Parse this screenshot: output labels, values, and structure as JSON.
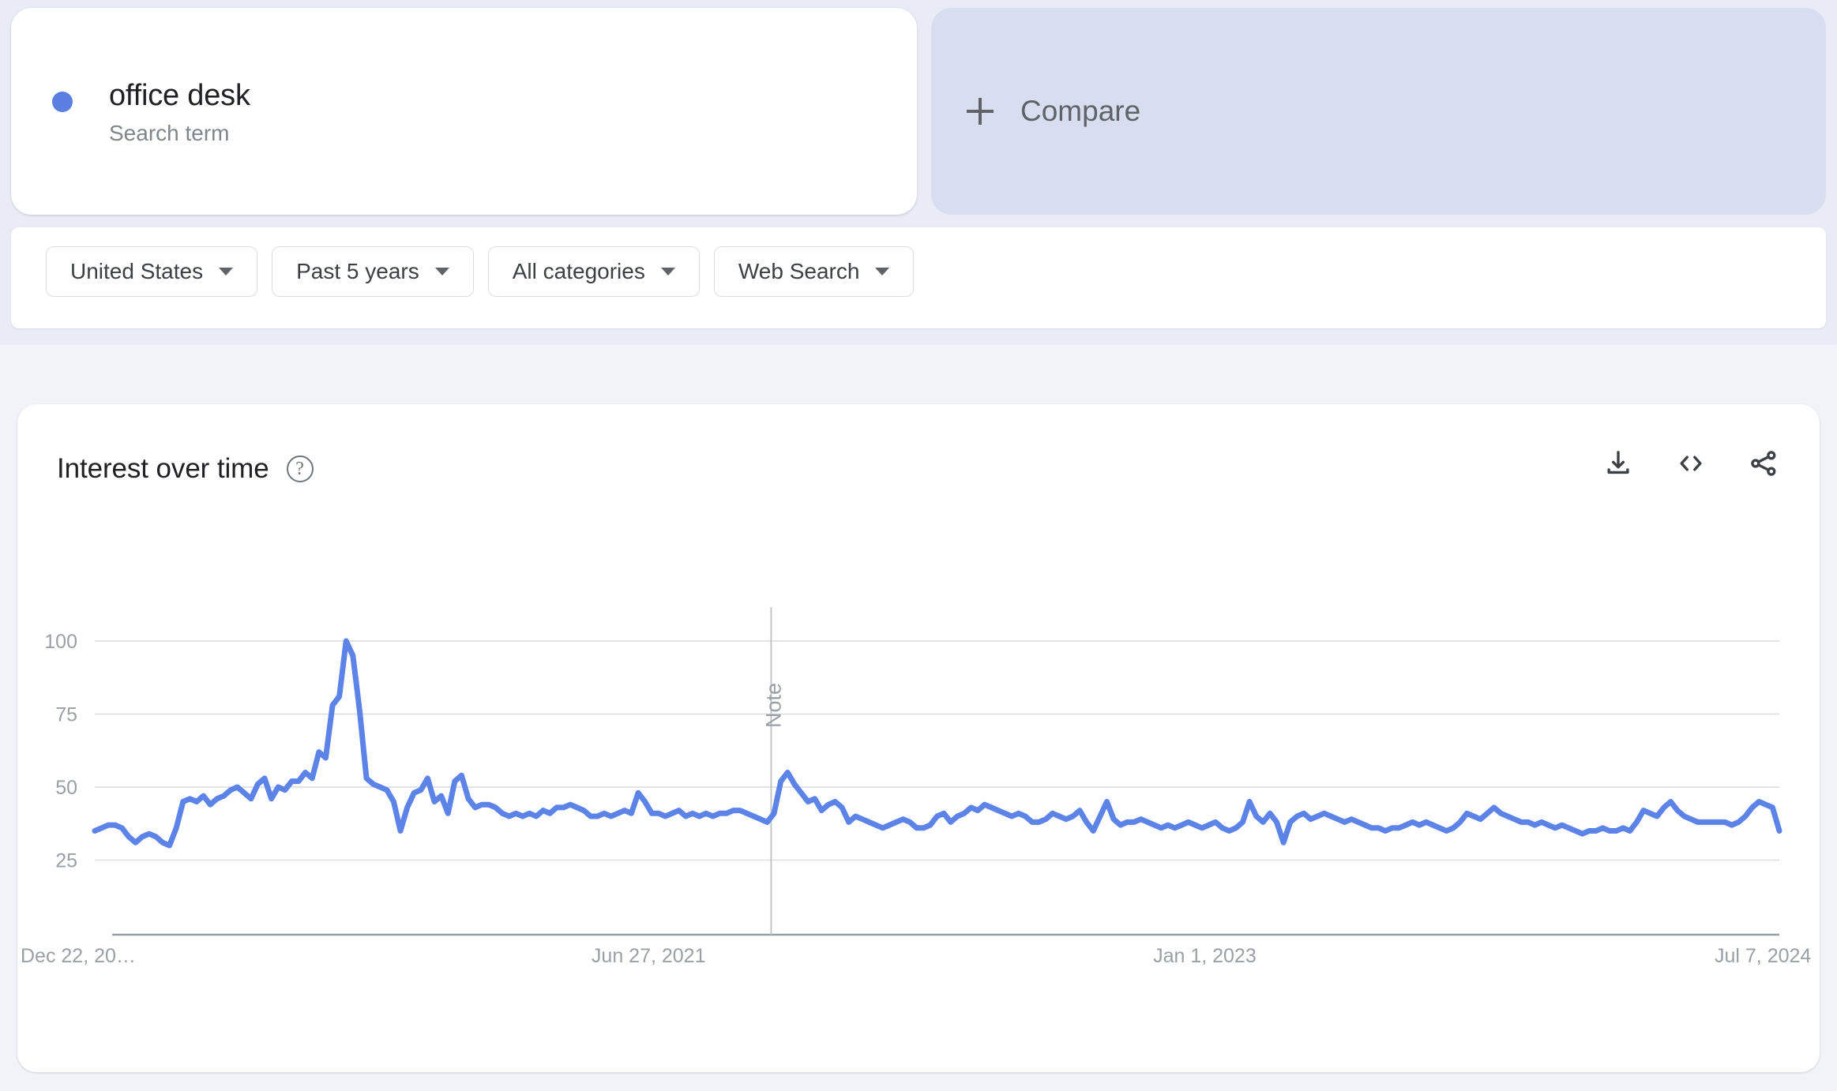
{
  "colors": {
    "page_background": "#eef0f8",
    "top_band": "#e9ecf7",
    "card_background": "#ffffff",
    "compare_background": "#d6deef",
    "series_blue": "#5b83e8",
    "legend_dot": "#5b7fe0",
    "text_primary": "#202124",
    "text_secondary": "#5f6368",
    "text_muted": "#9aa0a6",
    "gridline": "#dadce0"
  },
  "term_card": {
    "term": "office desk",
    "type_label": "Search term",
    "dot_color": "#5b7fe0"
  },
  "compare_card": {
    "label": "Compare",
    "icon": "plus-icon"
  },
  "filters": [
    {
      "label": "United States",
      "icon": "chevron-down-icon",
      "name": "location"
    },
    {
      "label": "Past 5 years",
      "icon": "chevron-down-icon",
      "name": "time-range"
    },
    {
      "label": "All categories",
      "icon": "chevron-down-icon",
      "name": "category"
    },
    {
      "label": "Web Search",
      "icon": "chevron-down-icon",
      "name": "search-type"
    }
  ],
  "chart_card": {
    "title": "Interest over time",
    "help_icon": "help-circle-icon",
    "help_glyph": "?",
    "actions": [
      {
        "name": "download-csv-button",
        "icon": "download-icon"
      },
      {
        "name": "embed-button",
        "icon": "code-embed-icon"
      },
      {
        "name": "share-button",
        "icon": "share-icon"
      }
    ]
  },
  "chart_data": {
    "type": "line",
    "title": "Interest over time",
    "subtitle": "",
    "xlabel": "",
    "ylabel": "",
    "ylim": [
      0,
      100
    ],
    "yticks": [
      25,
      50,
      75,
      100
    ],
    "ytick_labels": [
      "25",
      "50",
      "75",
      "100"
    ],
    "xtick_labels": [
      "Dec 22, 20…",
      "Jun 27, 2021",
      "Jan 1, 2023",
      "Jul 7, 2024"
    ],
    "xtick_positions": [
      0,
      0.3333,
      0.6667,
      1.0
    ],
    "grid": true,
    "legend": [
      "office desk"
    ],
    "legend_position": "top-card",
    "series_color": "#5b83e8",
    "annotations": [
      {
        "label": "Note",
        "x_fraction": 0.4015,
        "orientation": "vertical",
        "has_marker_line": true
      }
    ],
    "series": [
      {
        "name": "office desk",
        "values": [
          35,
          36,
          37,
          37,
          36,
          33,
          31,
          33,
          34,
          33,
          31,
          30,
          36,
          45,
          46,
          45,
          47,
          44,
          46,
          47,
          49,
          50,
          48,
          46,
          51,
          53,
          46,
          50,
          49,
          52,
          52,
          55,
          53,
          62,
          60,
          78,
          81,
          100,
          95,
          76,
          53,
          51,
          50,
          49,
          45,
          35,
          43,
          48,
          49,
          53,
          45,
          47,
          41,
          52,
          54,
          46,
          43,
          44,
          44,
          43,
          41,
          40,
          41,
          40,
          41,
          40,
          42,
          41,
          43,
          43,
          44,
          43,
          42,
          40,
          40,
          41,
          40,
          41,
          42,
          41,
          48,
          45,
          41,
          41,
          40,
          41,
          42,
          40,
          41,
          40,
          41,
          40,
          41,
          41,
          42,
          42,
          41,
          40,
          39,
          38,
          41,
          52,
          55,
          51,
          48,
          45,
          46,
          42,
          44,
          45,
          43,
          38,
          40,
          39,
          38,
          37,
          36,
          37,
          38,
          39,
          38,
          36,
          36,
          37,
          40,
          41,
          38,
          40,
          41,
          43,
          42,
          44,
          43,
          42,
          41,
          40,
          41,
          40,
          38,
          38,
          39,
          41,
          40,
          39,
          40,
          42,
          38,
          35,
          40,
          45,
          39,
          37,
          38,
          38,
          39,
          38,
          37,
          36,
          37,
          36,
          37,
          38,
          37,
          36,
          37,
          38,
          36,
          35,
          36,
          38,
          45,
          40,
          38,
          41,
          38,
          31,
          38,
          40,
          41,
          39,
          40,
          41,
          40,
          39,
          38,
          39,
          38,
          37,
          36,
          36,
          35,
          36,
          36,
          37,
          38,
          37,
          38,
          37,
          36,
          35,
          36,
          38,
          41,
          40,
          39,
          41,
          43,
          41,
          40,
          39,
          38,
          38,
          37,
          38,
          37,
          36,
          37,
          36,
          35,
          34,
          35,
          35,
          36,
          35,
          35,
          36,
          35,
          38,
          42,
          41,
          40,
          43,
          45,
          42,
          40,
          39,
          38,
          38,
          38,
          38,
          38,
          37,
          38,
          40,
          43,
          45,
          44,
          43,
          35
        ]
      }
    ]
  }
}
